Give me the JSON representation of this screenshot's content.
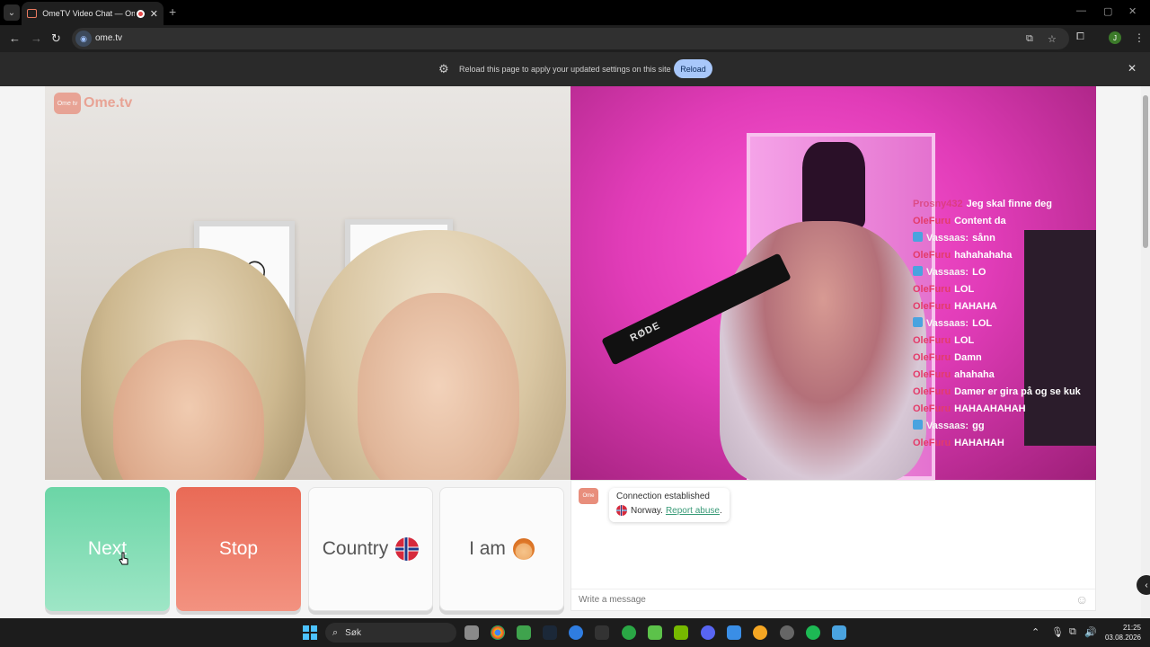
{
  "browser": {
    "tab_title": "OmeTV Video Chat — Ome",
    "tab_close": "✕",
    "new_tab": "+",
    "url": "ome.tv",
    "window_controls": [
      "—",
      "▢",
      "✕"
    ]
  },
  "infobar": {
    "message": "Reload this page to apply your updated settings on this site",
    "reload_label": "Reload",
    "dismiss": "✕"
  },
  "logo": {
    "tv": "Ome tv",
    "word": "Ome.tv"
  },
  "stream": {
    "mic_brand": "RØDE",
    "chat": [
      {
        "user": "Prosny432",
        "text": "Jeg skal finne deg",
        "style": "prosny"
      },
      {
        "user": "OleFuru",
        "text": "Content da",
        "style": "olefuru"
      },
      {
        "user": "Vassaas:",
        "text": "sånn",
        "style": "vassaas"
      },
      {
        "user": "OleFuru",
        "text": "hahahahaha",
        "style": "olefuru"
      },
      {
        "user": "Vassaas:",
        "text": "LO",
        "style": "vassaas"
      },
      {
        "user": "OleFuru",
        "text": "LOL",
        "style": "olefuru"
      },
      {
        "user": "OleFuru",
        "text": "HAHAHA",
        "style": "olefuru"
      },
      {
        "user": "Vassaas:",
        "text": "LOL",
        "style": "vassaas"
      },
      {
        "user": "OleFuru",
        "text": "LOL",
        "style": "olefuru"
      },
      {
        "user": "OleFuru",
        "text": "Damn",
        "style": "olefuru"
      },
      {
        "user": "OleFuru",
        "text": "ahahaha",
        "style": "olefuru"
      },
      {
        "user": "OleFuru",
        "text": "Damer er gira på og se kuk",
        "style": "olefuru"
      },
      {
        "user": "OleFuru",
        "text": "HAHAAHAHAH",
        "style": "olefuru"
      },
      {
        "user": "Vassaas:",
        "text": "gg",
        "style": "vassaas"
      },
      {
        "user": "OleFuru",
        "text": "HAHAHAH",
        "style": "olefuru"
      }
    ]
  },
  "controls": {
    "next": "Next",
    "stop": "Stop",
    "country": "Country",
    "i_am": "I am"
  },
  "chat_panel": {
    "status": "Connection established",
    "country": "Norway.",
    "report": "Report abuse",
    "report_suffix": ".",
    "input_placeholder": "Write a message"
  },
  "taskbar": {
    "search_label": "Søk",
    "time": "21:25",
    "date": "03.08.2026"
  },
  "colors": {
    "next": "#6bd5a6",
    "stop": "#e96a56",
    "accent_reload": "#a8c7fa"
  }
}
